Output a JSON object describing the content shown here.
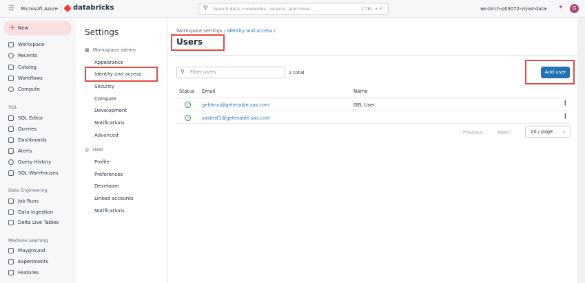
{
  "topbar": {
    "brand": "Microsoft Azure",
    "product": "databricks",
    "search_placeholder": "Search data, notebooks, recents, and more...",
    "search_shortcut": "CTRL + P",
    "workspace": "ws-birch-p03072-viya4-data",
    "avatar": "G"
  },
  "sidebar": {
    "new": "New",
    "items": [
      {
        "label": "Workspace",
        "icon": "folder-icon"
      },
      {
        "label": "Recents",
        "icon": "clock-icon"
      },
      {
        "label": "Catalog",
        "icon": "catalog-icon"
      },
      {
        "label": "Workflows",
        "icon": "workflows-icon"
      },
      {
        "label": "Compute",
        "icon": "cloud-icon"
      }
    ],
    "sql_section": "SQL",
    "sql_items": [
      {
        "label": "SQL Editor"
      },
      {
        "label": "Queries"
      },
      {
        "label": "Dashboards"
      },
      {
        "label": "Alerts"
      },
      {
        "label": "Query History"
      },
      {
        "label": "SQL Warehouses"
      }
    ],
    "de_section": "Data Engineering",
    "de_items": [
      {
        "label": "Job Runs"
      },
      {
        "label": "Data Ingestion"
      },
      {
        "label": "Delta Live Tables"
      }
    ],
    "ml_section": "Machine Learning",
    "ml_items": [
      {
        "label": "Playground"
      },
      {
        "label": "Experiments"
      },
      {
        "label": "Features"
      }
    ]
  },
  "settings": {
    "title": "Settings",
    "admin_header": "Workspace admin",
    "admin_items": [
      "Appearance",
      "Identity and access",
      "Security",
      "Compute",
      "Development",
      "Notifications",
      "Advanced"
    ],
    "user_header": "User",
    "user_items": [
      "Profile",
      "Preferences",
      "Developer",
      "Linked accounts",
      "Notifications"
    ]
  },
  "main": {
    "breadcrumb": {
      "root": "Workspace settings",
      "sep": "/",
      "current": "Identity and access",
      "trail": "/"
    },
    "title": "Users",
    "filter_placeholder": "Filter users",
    "total": "2 total",
    "add_user": "Add user",
    "columns": {
      "status": "Status",
      "email": "Email",
      "name": "Name"
    },
    "rows": [
      {
        "email": "geldmui@gelenable.sas.com",
        "name": "GEL User"
      },
      {
        "email": "sastest1@gelenable.sas.com",
        "name": ""
      }
    ],
    "pagination": {
      "previous": "Previous",
      "next": "Next",
      "page_size": "20 / page"
    }
  },
  "colors": {
    "primary": "#2272b4",
    "highlight": "#e8473f",
    "new_bg": "#f8e1e1"
  }
}
